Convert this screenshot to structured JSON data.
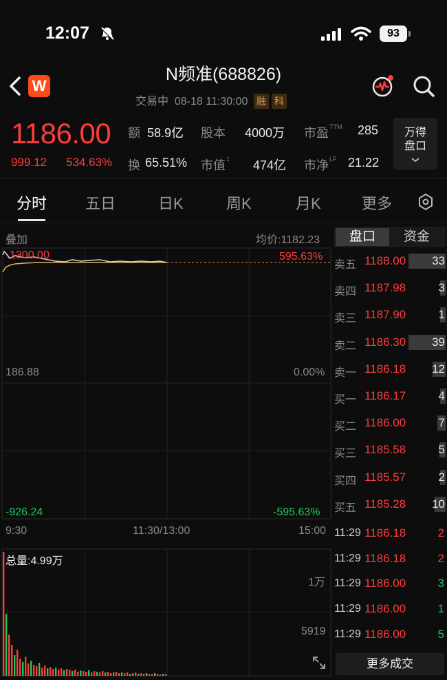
{
  "status_bar": {
    "time": "12:07",
    "battery": "93"
  },
  "header": {
    "logo_letter": "W",
    "title": "N频准(688826)",
    "status": "交易中",
    "datetime": "08-18 11:30:00",
    "tags": [
      "融",
      "科"
    ]
  },
  "quote": {
    "price": "1186.00",
    "change": "999.12",
    "change_pct": "534.63%",
    "stats": [
      {
        "label": "额",
        "value": "58.9亿"
      },
      {
        "label": "股本",
        "value": "4000万"
      },
      {
        "label": "市盈",
        "sup": "TTM",
        "value": "285"
      },
      {
        "label": "换",
        "value": "65.51%"
      },
      {
        "label": "市值",
        "sup": "1",
        "value": "474亿"
      },
      {
        "label": "市净",
        "sup": "LF",
        "value": "21.22"
      }
    ],
    "wande_button": [
      "万得",
      "盘口"
    ]
  },
  "tabs": [
    "分时",
    "五日",
    "日K",
    "周K",
    "月K",
    "更多"
  ],
  "chart": {
    "overlay_label": "叠加",
    "avg_price": "均价:1182.23",
    "price_high": "1300.00",
    "price_mid": "186.88",
    "price_low": "-926.24",
    "pct_high": "595.63%",
    "pct_mid": "0.00%",
    "pct_low": "-595.63%",
    "time_start": "9:30",
    "time_mid": "11:30/13:00",
    "time_end": "15:00",
    "total_volume": "总量:4.99万",
    "vol_top": "1万",
    "vol_mid": "5919"
  },
  "panel": {
    "tab_active": "盘口",
    "tab_other": "资金"
  },
  "order_book": [
    {
      "label": "卖五",
      "price": "1188.00",
      "vol": "33",
      "bar": 1.0
    },
    {
      "label": "卖四",
      "price": "1187.98",
      "vol": "3",
      "bar": 0.12
    },
    {
      "label": "卖三",
      "price": "1187.90",
      "vol": "1",
      "bar": 0.08
    },
    {
      "label": "卖二",
      "price": "1186.30",
      "vol": "39",
      "bar": 1.0
    },
    {
      "label": "卖一",
      "price": "1186.18",
      "vol": "12",
      "bar": 0.36
    },
    {
      "label": "买一",
      "price": "1186.17",
      "vol": "4",
      "bar": 0.14
    },
    {
      "label": "买二",
      "price": "1186.00",
      "vol": "7",
      "bar": 0.22
    },
    {
      "label": "买三",
      "price": "1185.58",
      "vol": "5",
      "bar": 0.16
    },
    {
      "label": "买四",
      "price": "1185.57",
      "vol": "2",
      "bar": 0.1
    },
    {
      "label": "买五",
      "price": "1185.28",
      "vol": "10",
      "bar": 0.3
    }
  ],
  "trades": [
    {
      "time": "11:29",
      "price": "1186.18",
      "vol": "2",
      "color": "#ff3b3b"
    },
    {
      "time": "11:29",
      "price": "1186.18",
      "vol": "2",
      "color": "#ff3b3b"
    },
    {
      "time": "11:29",
      "price": "1186.00",
      "vol": "3",
      "color": "#22c55e"
    },
    {
      "time": "11:29",
      "price": "1186.00",
      "vol": "1",
      "color": "#22c55e"
    },
    {
      "time": "11:29",
      "price": "1186.00",
      "vol": "5",
      "color": "#22c55e"
    }
  ],
  "more_trades_label": "更多成交",
  "colors": {
    "up": "#ff3b3b",
    "down": "#22c55e",
    "avg_line": "#e0b060",
    "price_line": "#cfcfcf"
  }
}
